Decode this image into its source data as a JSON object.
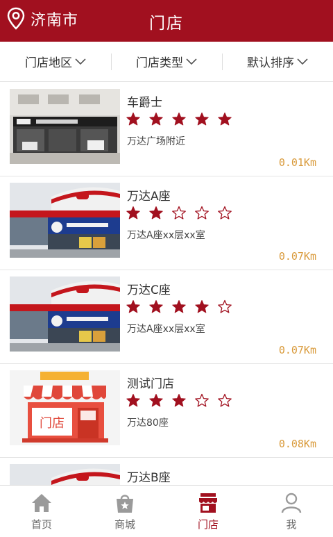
{
  "header": {
    "city": "济南市",
    "title": "门店"
  },
  "filters": [
    {
      "label": "门店地区"
    },
    {
      "label": "门店类型"
    },
    {
      "label": "默认排序"
    }
  ],
  "colors": {
    "brand": "#a1101f",
    "distance": "#d99a3a",
    "star": "#a1101f"
  },
  "stores": [
    {
      "name": "车爵士",
      "rating": 5,
      "address": "万达广场附近",
      "distance": "0.01Km"
    },
    {
      "name": "万达A座",
      "rating": 2,
      "address": "万达A座xx层xx室",
      "distance": "0.07Km"
    },
    {
      "name": "万达C座",
      "rating": 4,
      "address": "万达A座xx层xx室",
      "distance": "0.07Km"
    },
    {
      "name": "测试门店",
      "rating": 3,
      "address": "万达80座",
      "distance": "0.08Km",
      "thumb_text": "门店"
    },
    {
      "name": "万达B座"
    }
  ],
  "tabbar": [
    {
      "label": "首页",
      "icon": "home-icon"
    },
    {
      "label": "商城",
      "icon": "shopping-bag-icon"
    },
    {
      "label": "门店",
      "icon": "store-icon",
      "active": true
    },
    {
      "label": "我",
      "icon": "user-icon"
    }
  ]
}
